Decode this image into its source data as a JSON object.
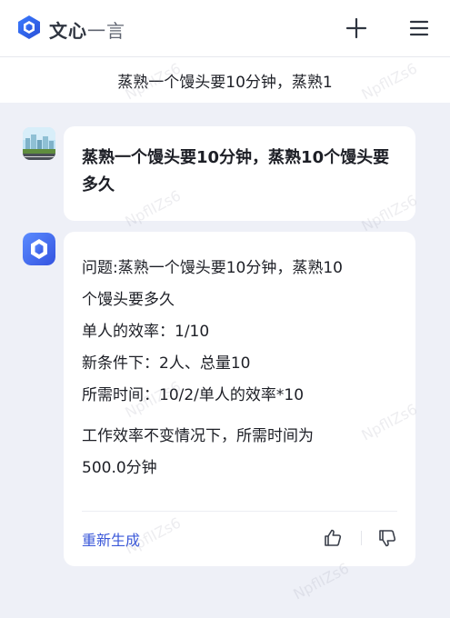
{
  "app": {
    "brand_bold": "文心",
    "brand_light": "一言"
  },
  "header": {
    "conversation_title": "蒸熟一个馒头要10分钟，蒸熟1"
  },
  "messages": {
    "user": {
      "text": "蒸熟一个馒头要10分钟，蒸熟10个馒头要多久"
    },
    "bot": {
      "lines": [
        "问题:蒸熟一个馒头要10分钟，蒸熟10",
        "个馒头要多久",
        "单人的效率：1/10",
        "新条件下：2人、总量10",
        "所需时间：10/2/单人的效率*10"
      ],
      "conclusion_lines": [
        "工作效率不变情况下，所需时间为",
        "500.0分钟"
      ],
      "regenerate_label": "重新生成"
    }
  },
  "watermark": "NpflIZs6",
  "colors": {
    "accent": "#3b58d9",
    "background": "#eef0f7"
  }
}
